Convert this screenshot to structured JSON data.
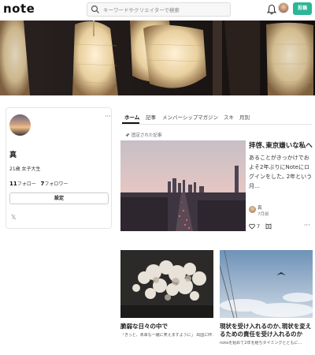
{
  "header": {
    "logo": "note",
    "search_placeholder": "キーワードやクリエイターで検索",
    "post_label": "投稿"
  },
  "profile": {
    "name": "真",
    "bio": "21歳 女子大生",
    "following_count": "11",
    "following_label": "フォロー",
    "followers_count": "7",
    "followers_label": "フォロワー",
    "settings_label": "設定",
    "more": "···",
    "x_label": "𝕏"
  },
  "tabs": [
    "ホーム",
    "記事",
    "メンバーシップ",
    "マガジン",
    "スキ",
    "月別"
  ],
  "pinned_label": "固定された記事",
  "featured": {
    "title": "拝啓､東京嫌いな私へ",
    "excerpt": "あることがきっかけでおよそ2年ぶりにNoteにログインをした｡ 2年という月…",
    "author": "真",
    "date": "7月前",
    "likes": "7"
  },
  "cards": [
    {
      "title": "脆弱な日々の中で",
      "excerpt": "「きっと、未来も一緒に笑えますように」 出国に昨…"
    },
    {
      "title": "現状を受け入れるのか､現状を変えるための責任を受け入れるのか",
      "excerpt": "noteを始めて2年を経ちタイミングとともに…"
    }
  ],
  "colors": {
    "accent": "#2cb696"
  },
  "icons": {
    "search": "search-icon",
    "bell": "bell-icon",
    "pin": "pin-icon",
    "like": "heart-icon",
    "magazine": "magazine-icon",
    "more": "more-icon",
    "x": "x-icon"
  }
}
